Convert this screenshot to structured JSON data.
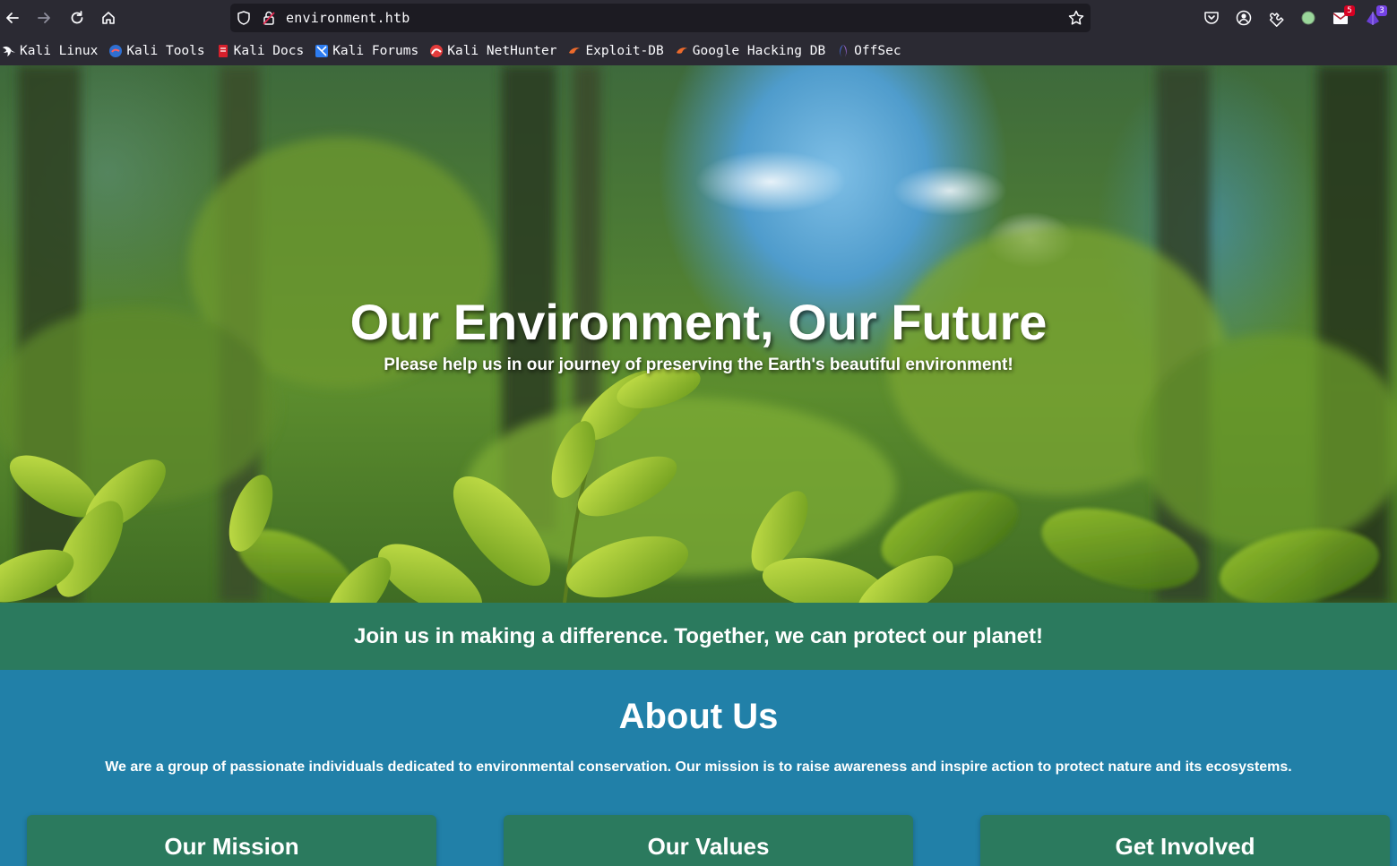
{
  "browser": {
    "url": "environment.htb",
    "bookmarks": [
      {
        "label": "Kali Linux",
        "icon": "kali-dragon-icon"
      },
      {
        "label": "Kali Tools",
        "icon": "kali-tools-icon"
      },
      {
        "label": "Kali Docs",
        "icon": "kali-docs-icon"
      },
      {
        "label": "Kali Forums",
        "icon": "kali-forums-icon"
      },
      {
        "label": "Kali NetHunter",
        "icon": "kali-nethunter-icon"
      },
      {
        "label": "Exploit-DB",
        "icon": "exploit-db-icon"
      },
      {
        "label": "Google Hacking DB",
        "icon": "ghdb-icon"
      },
      {
        "label": "OffSec",
        "icon": "offsec-icon"
      }
    ],
    "extension_badges": {
      "mail": "5",
      "purple": "3"
    },
    "colors": {
      "toolbar": "#2b2a33",
      "urlbar": "#1c1b22"
    }
  },
  "hero": {
    "title": "Our Environment, Our Future",
    "subtitle": "Please help us in our journey of preserving the Earth's beautiful environment!"
  },
  "cta": {
    "text": "Join us in making a difference. Together, we can protect our planet!"
  },
  "about": {
    "title": "About Us",
    "description": "We are a group of passionate individuals dedicated to environmental conservation. Our mission is to raise awareness and inspire action to protect nature and its ecosystems.",
    "cards": [
      {
        "title": "Our Mission"
      },
      {
        "title": "Our Values"
      },
      {
        "title": "Get Involved"
      }
    ]
  },
  "theme": {
    "green": "#2b7a5e",
    "blue": "#2180a8"
  }
}
